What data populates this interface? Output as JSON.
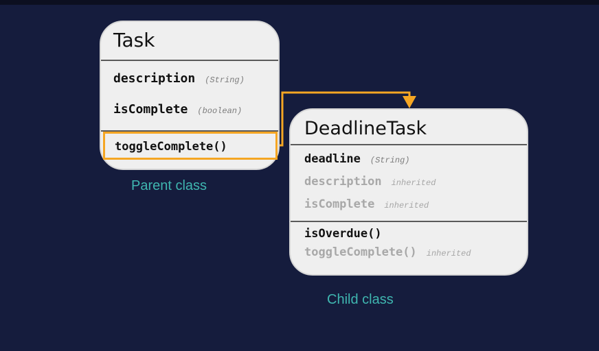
{
  "parent_class": {
    "name": "Task",
    "fields": [
      {
        "name": "description",
        "type": "(String)"
      },
      {
        "name": "isComplete",
        "type": "(boolean)"
      }
    ],
    "methods": [
      {
        "name": "toggleComplete()"
      }
    ]
  },
  "child_class": {
    "name": "DeadlineTask",
    "fields": [
      {
        "name": "deadline",
        "type": "(String)"
      },
      {
        "name": "description",
        "type": "inherited"
      },
      {
        "name": "isComplete",
        "type": "inherited"
      }
    ],
    "methods": [
      {
        "name": "isOverdue()"
      },
      {
        "name": "toggleComplete()",
        "type": "inherited"
      }
    ]
  },
  "captions": {
    "parent": "Parent class",
    "child": "Child class"
  },
  "colors": {
    "background": "#151c3d",
    "box_fill": "#efefef",
    "highlight_arrow": "#f5a623",
    "caption": "#3fb6b0"
  }
}
